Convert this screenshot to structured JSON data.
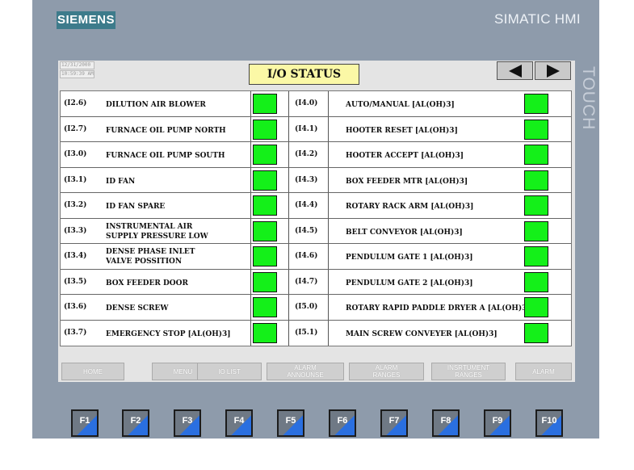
{
  "panel": {
    "brand": "SIEMENS",
    "model": "SIMATIC HMI",
    "side_label": "TOUCH"
  },
  "screen": {
    "date": "12/31/2000",
    "time": "10:59:39 AM",
    "title": "I/O STATUS",
    "nav_prev": "◀",
    "nav_next": "▶",
    "indicator_color": "#14f019"
  },
  "left_rows": [
    {
      "addr": "(I2.6)",
      "label": "DILUTION AIR BLOWER",
      "state": "on"
    },
    {
      "addr": "(I2.7)",
      "label": "FURNACE OIL PUMP NORTH",
      "state": "on"
    },
    {
      "addr": "(I3.0)",
      "label": "FURNACE OIL PUMP SOUTH",
      "state": "on"
    },
    {
      "addr": "(I3.1)",
      "label": "ID FAN",
      "state": "on"
    },
    {
      "addr": "(I3.2)",
      "label": "ID FAN SPARE",
      "state": "on"
    },
    {
      "addr": "(I3.3)",
      "label": "INSTRUMENTAL AIR",
      "label2": "SUPPLY PRESSURE LOW",
      "state": "on"
    },
    {
      "addr": "(I3.4)",
      "label": "DENSE PHASE INLET",
      "label2": "VALVE POSSITION",
      "state": "on"
    },
    {
      "addr": "(I3.5)",
      "label": "BOX FEEDER DOOR",
      "state": "on"
    },
    {
      "addr": "(I3.6)",
      "label": "DENSE SCREW",
      "state": "on"
    },
    {
      "addr": "(I3.7)",
      "label": "EMERGENCY STOP [AL(OH)3]",
      "state": "on"
    }
  ],
  "right_rows": [
    {
      "addr": "(I4.0)",
      "label": "AUTO/MANUAL [AL(OH)3]",
      "state": "on"
    },
    {
      "addr": "(I4.1)",
      "label": "HOOTER RESET [AL(OH)3]",
      "state": "on"
    },
    {
      "addr": "(I4.2)",
      "label": "HOOTER ACCEPT [AL(OH)3]",
      "state": "on"
    },
    {
      "addr": "(I4.3)",
      "label": "BOX FEEDER MTR [AL(OH)3]",
      "state": "on"
    },
    {
      "addr": "(I4.4)",
      "label": "ROTARY RACK ARM [AL(OH)3]",
      "state": "on"
    },
    {
      "addr": "(I4.5)",
      "label": "BELT CONVEYOR [AL(OH)3]",
      "state": "on"
    },
    {
      "addr": "(I4.6)",
      "label": "PENDULUM GATE 1 [AL(OH)3]",
      "state": "on"
    },
    {
      "addr": "(I4.7)",
      "label": "PENDULUM GATE 2 [AL(OH)3]",
      "state": "on"
    },
    {
      "addr": "(I5.0)",
      "label": "ROTARY RAPID PADDLE DRYER A [AL(OH)3]",
      "state": "on"
    },
    {
      "addr": "(I5.1)",
      "label": "MAIN SCREW CONVEYER [AL(OH)3]",
      "state": "on"
    }
  ],
  "screen_buttons": [
    {
      "label": "HOME"
    },
    {
      "label": "MENU"
    },
    {
      "label": "IO LIST"
    },
    {
      "label": "ALARM",
      "label2": "ANNOUNSE"
    },
    {
      "label": "ALARM",
      "label2": "RANGES"
    },
    {
      "label": "INSRTUMENT",
      "label2": "RANGES"
    },
    {
      "label": "ALARM"
    }
  ],
  "function_keys": [
    "F1",
    "F2",
    "F3",
    "F4",
    "F5",
    "F6",
    "F7",
    "F8",
    "F9",
    "F10"
  ]
}
